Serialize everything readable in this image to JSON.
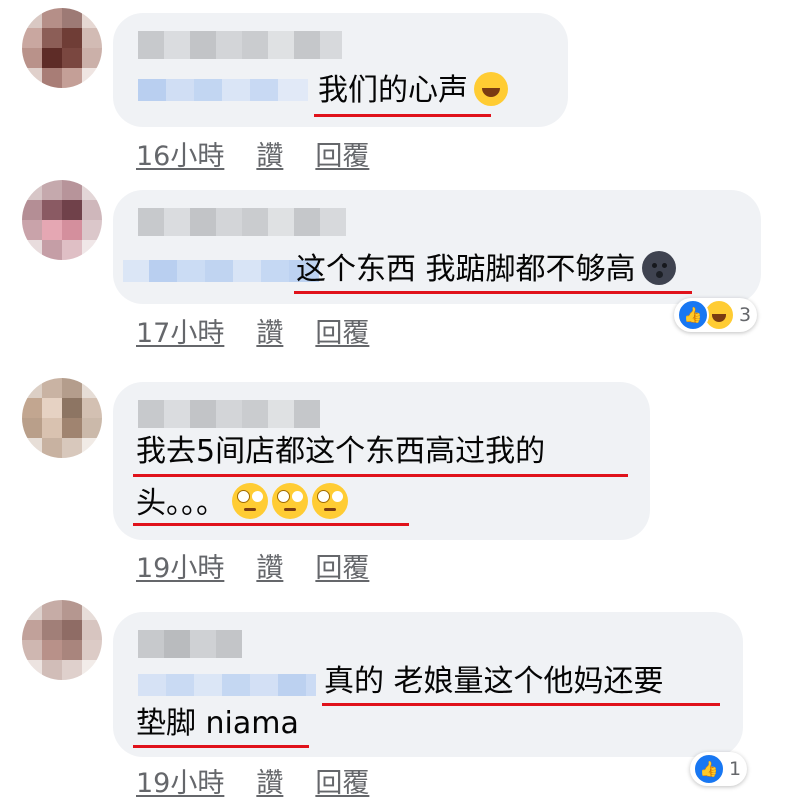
{
  "comments": [
    {
      "line1": "我们的心声",
      "emoji": "laugh-cry-emoji",
      "time": "16小時",
      "like": "讚",
      "reply": "回覆"
    },
    {
      "line1": "这个东西 我踮脚都不够高",
      "emoji": "new-moon-face-emoji",
      "time": "17小時",
      "like": "讚",
      "reply": "回覆",
      "reactions": {
        "icons": [
          "like-icon",
          "haha-icon"
        ],
        "count": "3"
      }
    },
    {
      "line1": "我去5间店都这个东西高过我的",
      "line2": "头。。。",
      "emoji": "eye-roll-emoji",
      "time": "19小時",
      "like": "讚",
      "reply": "回覆"
    },
    {
      "line1": "真的 老娘量这个他妈还要",
      "line2": "垫脚 niama",
      "time": "19小時",
      "like": "讚",
      "reply": "回覆",
      "reactions": {
        "icons": [
          "like-icon"
        ],
        "count": "1"
      }
    }
  ],
  "colors": {
    "bubble": "#f0f2f5",
    "underline": "#e0121b",
    "meta": "#65676b",
    "like": "#1877f2"
  }
}
